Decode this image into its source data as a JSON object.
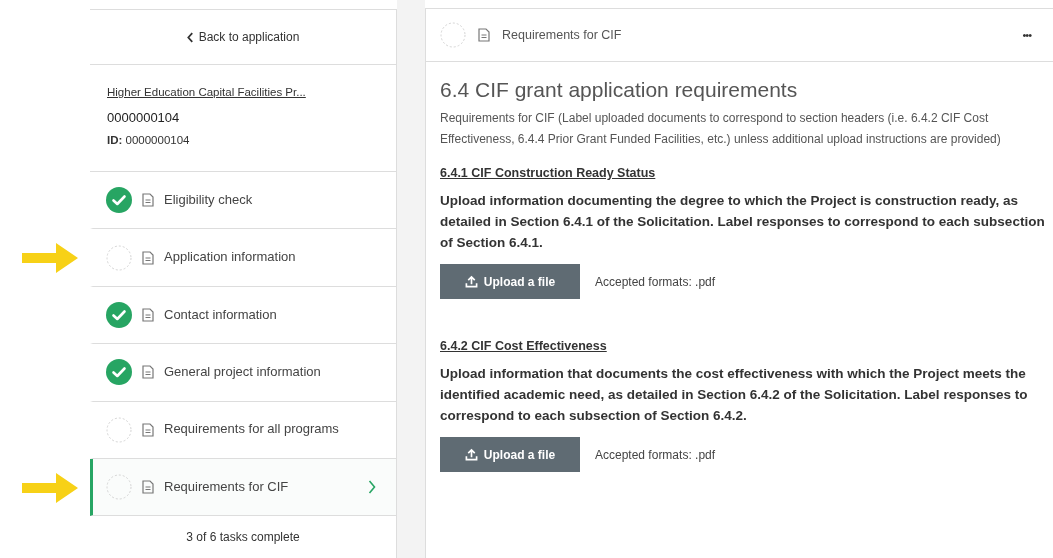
{
  "sidebar": {
    "back_link": "Back to application",
    "application": {
      "program_link": "Higher Education Capital Facilities Pr...",
      "number": "0000000104",
      "id_label": "ID:",
      "id_value": "0000000104"
    },
    "tasks": [
      {
        "label": "Eligibility check",
        "complete": true,
        "selected": false,
        "annotated": false
      },
      {
        "label": "Application information",
        "complete": false,
        "selected": false,
        "annotated": true
      },
      {
        "label": "Contact information",
        "complete": true,
        "selected": false,
        "annotated": false
      },
      {
        "label": "General project information",
        "complete": true,
        "selected": false,
        "annotated": false
      },
      {
        "label": "Requirements for all programs",
        "complete": false,
        "selected": false,
        "annotated": false
      },
      {
        "label": "Requirements for CIF",
        "complete": false,
        "selected": true,
        "annotated": true
      }
    ],
    "progress": "3 of 6 tasks complete"
  },
  "main": {
    "header": {
      "title": "Requirements for CIF",
      "complete": false,
      "menu": "•••"
    },
    "title": "6.4 CIF grant application requirements",
    "description": "Requirements for CIF (Label uploaded documents to correspond to section headers (i.e. 6.4.2 CIF Cost Effectiveness, 6.4.4 Prior Grant Funded Facilities, etc.) unless additional upload instructions are provided)",
    "sections": [
      {
        "heading": "6.4.1 CIF Construction Ready Status",
        "instructions": "Upload information documenting the degree to which the Project is construction ready, as detailed in Section 6.4.1 of the Solicitation. Label responses to correspond to each subsection of Section 6.4.1.",
        "button": "Upload a file",
        "formats": "Accepted formats: .pdf"
      },
      {
        "heading": "6.4.2 CIF Cost Effectiveness",
        "instructions": "Upload information that documents the cost effectiveness with which the Project meets the identified academic need, as detailed in Section 6.4.2 of the Solicitation.  Label responses to correspond to each subsection of Section 6.4.2.",
        "button": "Upload a file",
        "formats": "Accepted formats: .pdf"
      }
    ]
  }
}
